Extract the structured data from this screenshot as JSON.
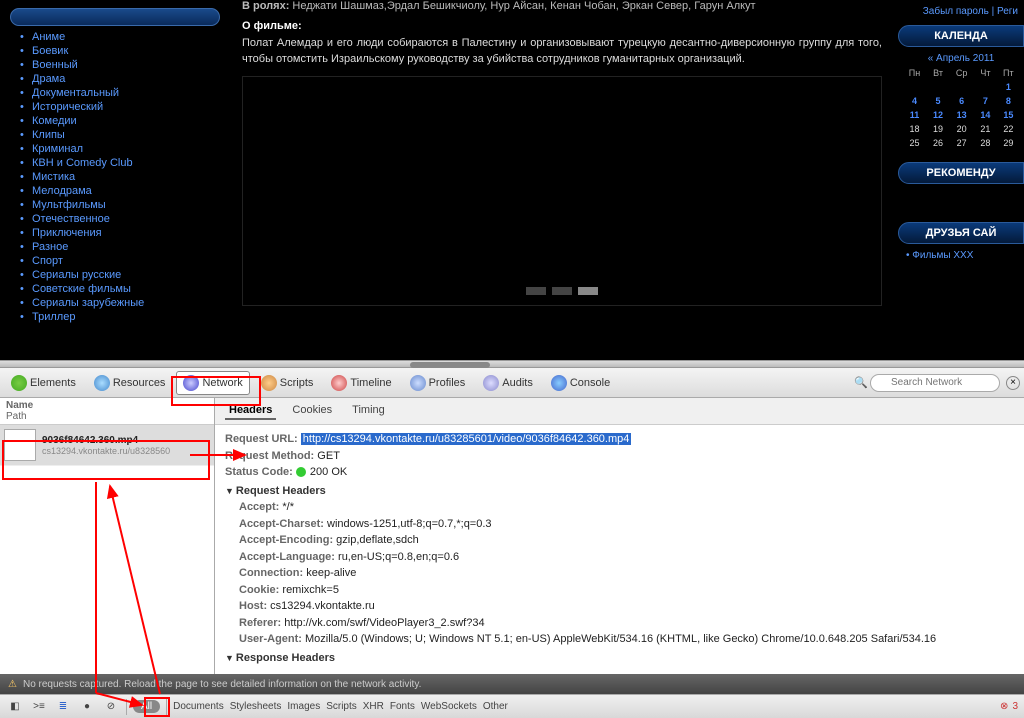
{
  "sidebar": {
    "items": [
      "Аниме",
      "Боевик",
      "Военный",
      "Драма",
      "Документальный",
      "Исторический",
      "Комедии",
      "Клипы",
      "Криминал",
      "КВН и Comedy Club",
      "Мистика",
      "Мелодрама",
      "Мультфильмы",
      "Отечественное",
      "Приключения",
      "Разное",
      "Спорт",
      "Сериалы русские",
      "Советские фильмы",
      "Сериалы зарубежные",
      "Триллер"
    ]
  },
  "movie": {
    "roles_label": "В ролях:",
    "roles": "Неджати Шашмаз,Эрдал Бешикчиолу, Нур Айсан, Кенан Чобан, Эркан Север, Гарун Алкут",
    "about_label": "О фильме:",
    "about_text": "Полат Алемдар и его люди собираются в Палестину и организовывают турецкую десантно-диверсионную группу для того, чтобы отомстить Израильскому руководству за убийства сотрудников гуманитарных организаций."
  },
  "right": {
    "forgot": "Забыл пароль",
    "reg": "Реги",
    "cal_title": "КАЛЕНДА",
    "cal_month": "«  Апрель 2011",
    "cal_days": [
      "Пн",
      "Вт",
      "Ср",
      "Чт",
      "Пт"
    ],
    "cal_rows": [
      [
        "",
        "",
        "",
        "",
        "1"
      ],
      [
        "4",
        "5",
        "6",
        "7",
        "8"
      ],
      [
        "11",
        "12",
        "13",
        "14",
        "15"
      ],
      [
        "18",
        "19",
        "20",
        "21",
        "22"
      ],
      [
        "25",
        "26",
        "27",
        "28",
        "29"
      ]
    ],
    "rec_title": "РЕКОМЕНДУ",
    "friends_title": "ДРУЗЬЯ САЙ",
    "friends_link": "Фильмы XXX"
  },
  "devtools": {
    "tabs": [
      "Elements",
      "Resources",
      "Network",
      "Scripts",
      "Timeline",
      "Profiles",
      "Audits",
      "Console"
    ],
    "search_ph": "Search Network",
    "list_hdr_name": "Name",
    "list_hdr_path": "Path",
    "item_name": "9036f84642.360.mp4",
    "item_path": "cs13294.vkontakte.ru/u8328560",
    "subtabs": [
      "Headers",
      "Cookies",
      "Timing"
    ],
    "req_url_label": "Request URL:",
    "req_url": "http://cs13294.vkontakte.ru/u83285601/video/9036f84642.360.mp4",
    "req_method_label": "Request Method:",
    "req_method": "GET",
    "status_label": "Status Code:",
    "status": "200 OK",
    "req_headers_label": "Request Headers",
    "headers": {
      "Accept": "*/*",
      "Accept-Charset": "windows-1251,utf-8;q=0.7,*;q=0.3",
      "Accept-Encoding": "gzip,deflate,sdch",
      "Accept-Language": "ru,en-US;q=0.8,en;q=0.6",
      "Connection": "keep-alive",
      "Cookie": "remixchk=5",
      "Host": "cs13294.vkontakte.ru",
      "Referer": "http://vk.com/swf/VideoPlayer3_2.swf?34",
      "User-Agent": "Mozilla/5.0 (Windows; U; Windows NT 5.1; en-US) AppleWebKit/534.16 (KHTML, like Gecko) Chrome/10.0.648.205 Safari/534.16"
    },
    "resp_headers_label": "Response Headers",
    "status_msg": "No requests captured. Reload the page to see detailed information on the network activity.",
    "footer_filters": [
      "All",
      "Documents",
      "Stylesheets",
      "Images",
      "Scripts",
      "XHR",
      "Fonts",
      "WebSockets",
      "Other"
    ],
    "error_count": "3"
  }
}
